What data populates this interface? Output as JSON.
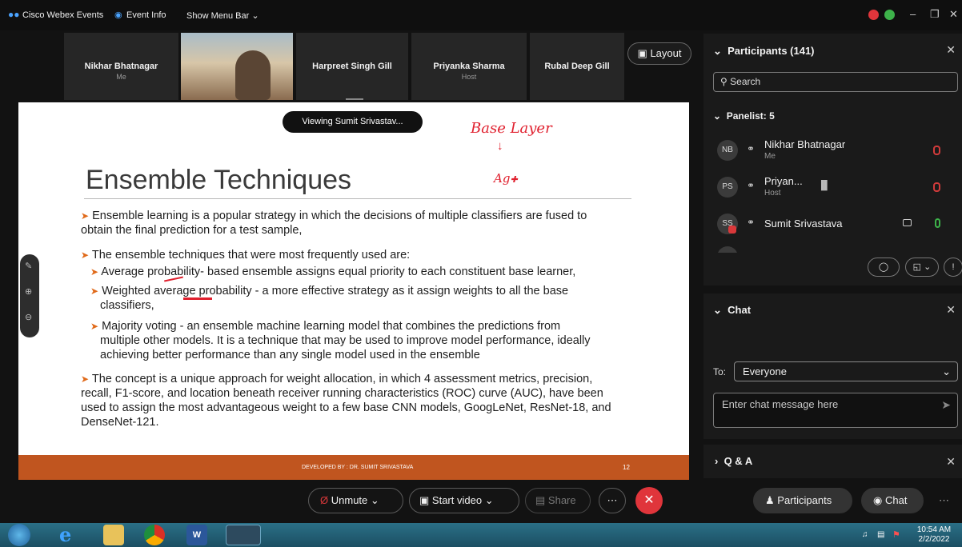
{
  "titlebar": {
    "app_name": "Cisco Webex Events",
    "event_info": "Event Info",
    "show_menu_bar": "Show Menu Bar"
  },
  "video_strip": {
    "tiles": [
      {
        "name": "Nikhar Bhatnagar",
        "sub": "Me"
      },
      {
        "name": "",
        "sub": ""
      },
      {
        "name": "Harpreet Singh Gill",
        "sub": ""
      },
      {
        "name": "Priyanka Sharma",
        "sub": "Host"
      },
      {
        "name": "Rubal Deep Gill",
        "sub": ""
      }
    ],
    "layout_label": "Layout"
  },
  "slide": {
    "viewing": "Viewing Sumit Srivastav...",
    "title": "Ensemble Techniques",
    "annotations": [
      "Base Layer",
      "Ag"
    ],
    "bullets": [
      "Ensemble learning is a popular strategy in which the decisions of multiple classifiers are fused to",
      "obtain the final prediction for a test sample,",
      "The ensemble techniques that were most frequently used are:",
      "Average probability- based ensemble assigns equal priority to each constituent base learner,",
      "Weighted average probability - a more effective strategy as it assign weights to all the base",
      "classifiers,",
      "Majority voting - an ensemble machine learning model that combines the predictions from",
      "multiple other models. It is a technique that may be used to improve model performance, ideally",
      "achieving better performance than any single model used in the ensemble",
      "The concept is a unique approach for weight allocation, in which 4 assessment metrics, precision,",
      "recall, F1-score, and location beneath receiver running characteristics (ROC) curve (AUC), have been",
      "used to assign the most advantageous weight to a few base CNN models, GoogLeNet, ResNet-18, and",
      "DenseNet-121."
    ],
    "footer": "DEVELOPED BY : DR. SUMIT SRIVASTAVA",
    "page": "12"
  },
  "participants": {
    "header": "Participants (141)",
    "search_placeholder": "Search",
    "panelist_header": "Panelist: 5",
    "list": [
      {
        "initials": "NB",
        "name": "Nikhar Bhatnagar",
        "sub": "Me"
      },
      {
        "initials": "PS",
        "name": "Priyan...",
        "sub": "Host"
      },
      {
        "initials": "SS",
        "name": "Sumit Srivastava",
        "sub": ""
      }
    ]
  },
  "chat": {
    "header": "Chat",
    "to_label": "To:",
    "to_value": "Everyone",
    "input_placeholder": "Enter chat message here"
  },
  "qa": {
    "header": "Q & A"
  },
  "toolbar": {
    "unmute": "Unmute",
    "start_video": "Start video",
    "share": "Share",
    "participants": "Participants",
    "chat": "Chat"
  },
  "taskbar": {
    "time": "10:54 AM",
    "date": "2/2/2022"
  },
  "colors": {
    "accent_red": "#d9383a",
    "slide_footer": "#c0551f",
    "bullet_arrow": "#e06a1a",
    "annotation": "#e0202e"
  }
}
